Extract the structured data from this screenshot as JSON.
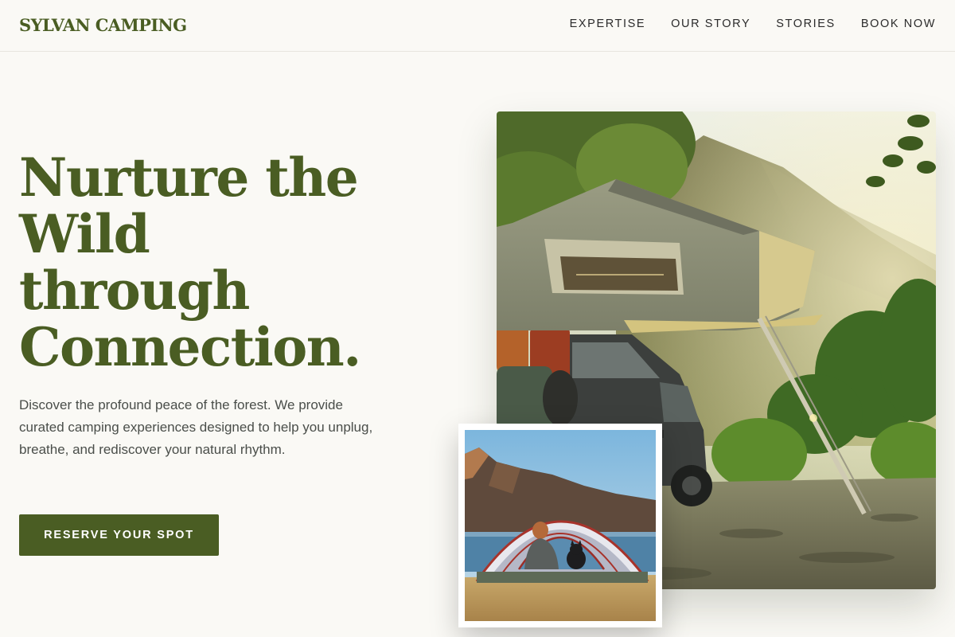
{
  "brand": {
    "name": "SYLVAN CAMPING"
  },
  "nav": {
    "items": [
      {
        "label": "EXPERTISE"
      },
      {
        "label": "OUR STORY"
      },
      {
        "label": "STORIES"
      },
      {
        "label": "BOOK NOW"
      }
    ]
  },
  "hero": {
    "headline_lines": [
      "Nurture the",
      "Wild",
      "through",
      "Connection."
    ],
    "description": "Discover the profound peace of the forest. We provide curated camping experiences designed to help you unplug, breathe, and rediscover your natural rhythm.",
    "cta_label": "RESERVE YOUR SPOT"
  },
  "colors": {
    "accent": "#4a5d23",
    "background": "#faf9f5",
    "body_text": "#4a4e4a"
  }
}
